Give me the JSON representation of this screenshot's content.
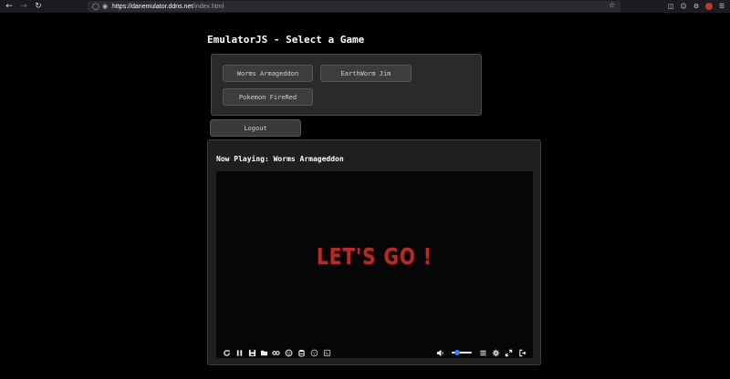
{
  "browser": {
    "url_host": "https://danemulator.ddns.net",
    "url_path": "/index.html"
  },
  "page": {
    "title": "EmulatorJS - Select a Game"
  },
  "games": [
    {
      "label": "Worms Armageddon"
    },
    {
      "label": "EarthWorm Jim"
    },
    {
      "label": "Pokemon FireRed"
    }
  ],
  "logout": {
    "label": "Logout"
  },
  "player": {
    "now_playing": "Now Playing: Worms Armageddon",
    "screen_text": "LET'S GO !",
    "volume_level": 0.25,
    "controls_left": [
      "restart-icon",
      "pause-icon",
      "save-icon",
      "load-icon",
      "cheats-icon",
      "gamepad-icon",
      "storage-icon",
      "netplay-icon",
      "context-icon"
    ],
    "controls_right": [
      "volume-icon",
      "menu-icon",
      "settings-icon",
      "fullscreen-icon",
      "exit-icon"
    ]
  },
  "colors": {
    "background": "#000000",
    "panel": "#2a2a2a",
    "button": "#3d3d3d",
    "game_text": "#b32b2b",
    "volume_accent": "#3b82f6"
  }
}
